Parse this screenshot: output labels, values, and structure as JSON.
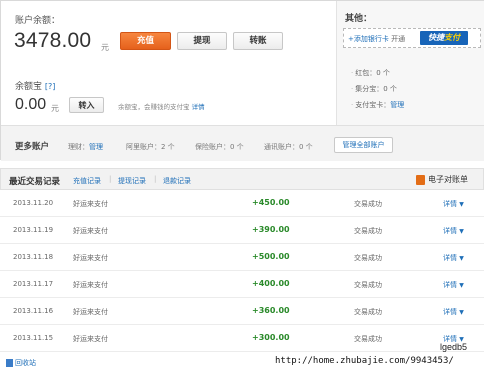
{
  "account": {
    "balance_label": "账户余额：",
    "balance_value": "3478.00",
    "balance_unit": "元",
    "buttons": {
      "recharge": "充值",
      "withdraw": "提现",
      "transfer": "转账"
    }
  },
  "yuebao": {
    "label": "余额宝",
    "help": "[?]",
    "value": "0.00",
    "unit": "元",
    "transfer_in": "转入",
    "desc": "余额宝，会赚钱的支付宝",
    "desc_link": "详情"
  },
  "other": {
    "title": "其他：",
    "add_card_link": "+添加银行卡",
    "add_card_text": "开通",
    "logo_text_a": "快捷",
    "logo_text_b": "支付",
    "items": [
      {
        "label": "红包：",
        "value": "0 个"
      },
      {
        "label": "集分宝：",
        "value": "0 个"
      },
      {
        "label": "支付宝卡：",
        "value": "管理"
      }
    ]
  },
  "more_accounts": {
    "title": "更多账户",
    "licai_label": "理财：",
    "licai_link": "管理",
    "alitrip": "阿里账户：2 个",
    "insurance": "保险账户：0 个",
    "telecom": "通讯账户：0 个",
    "manage_all": "管理全部账户"
  },
  "transactions": {
    "title": "最近交易记录",
    "tabs": [
      "充值记录",
      "提现记录",
      "退款记录"
    ],
    "ebill": "电子对账单",
    "detail_label": "详情",
    "rows": [
      {
        "date": "2013.11.20",
        "desc": "好运来支付",
        "amount": "+450.00",
        "status": "交易成功"
      },
      {
        "date": "2013.11.19",
        "desc": "好运来支付",
        "amount": "+390.00",
        "status": "交易成功"
      },
      {
        "date": "2013.11.18",
        "desc": "好运来支付",
        "amount": "+500.00",
        "status": "交易成功"
      },
      {
        "date": "2013.11.17",
        "desc": "好运来支付",
        "amount": "+400.00",
        "status": "交易成功"
      },
      {
        "date": "2013.11.16",
        "desc": "好运来支付",
        "amount": "+360.00",
        "status": "交易成功"
      },
      {
        "date": "2013.11.15",
        "desc": "好运来支付",
        "amount": "+300.00",
        "status": "交易成功"
      }
    ]
  },
  "footer": {
    "recycle": "回收站",
    "watermark_user": "lgedb5",
    "watermark_url": "http://home.zhubajie.com/9943453/"
  }
}
